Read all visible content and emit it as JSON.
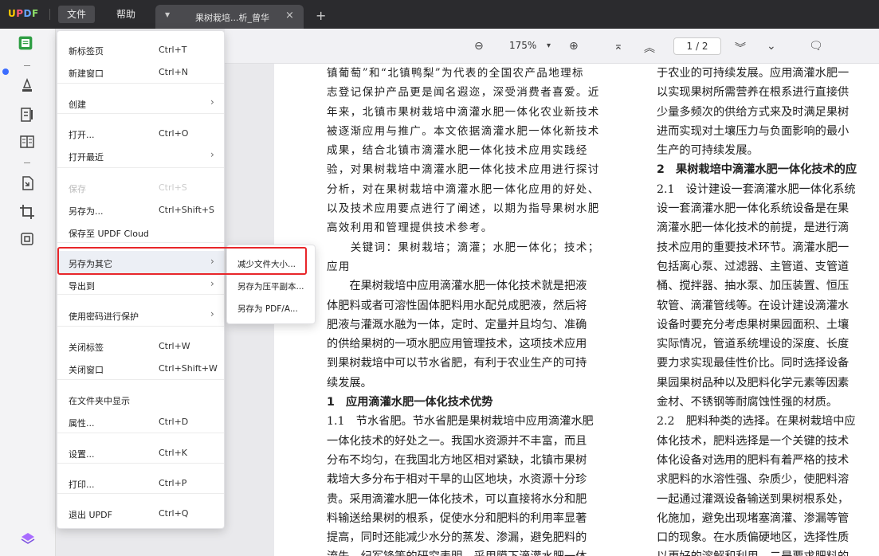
{
  "app": {
    "logo": "UPDF",
    "menus": [
      "文件",
      "帮助"
    ],
    "active_menu": "文件"
  },
  "tab": {
    "title": "果树栽培...析_曾华",
    "close": "×",
    "new_tab": "+"
  },
  "toolbar": {
    "zoom_out": "⊖",
    "zoom": "175%",
    "zoom_dropdown": "▾",
    "zoom_in": "⊕",
    "first_page": "⌅",
    "prev_page": "︽",
    "page_indicator": "1 / 2",
    "next_page": "︾",
    "last_page": "⌄",
    "comment": "🗨"
  },
  "file_menu": {
    "items": [
      {
        "label": "新标签页",
        "shortcut": "Ctrl+T"
      },
      {
        "label": "新建窗口",
        "shortcut": "Ctrl+N"
      },
      {
        "label": "创建",
        "shortcut": "",
        "submenu": true
      },
      {
        "label": "打开...",
        "shortcut": "Ctrl+O"
      },
      {
        "label": "打开最近",
        "shortcut": "",
        "submenu": true
      },
      {
        "label": "保存",
        "shortcut": "Ctrl+S",
        "disabled": true
      },
      {
        "label": "另存为...",
        "shortcut": "Ctrl+Shift+S"
      },
      {
        "label": "保存至 UPDF Cloud",
        "shortcut": ""
      },
      {
        "label": "另存为其它",
        "shortcut": "",
        "submenu": true,
        "highlighted": true
      },
      {
        "label": "导出到",
        "shortcut": "",
        "submenu": true
      },
      {
        "label": "使用密码进行保护",
        "shortcut": "",
        "submenu": true
      },
      {
        "label": "关闭标签",
        "shortcut": "Ctrl+W"
      },
      {
        "label": "关闭窗口",
        "shortcut": "Ctrl+Shift+W"
      },
      {
        "label": "在文件夹中显示",
        "shortcut": ""
      },
      {
        "label": "属性...",
        "shortcut": "Ctrl+D"
      },
      {
        "label": "设置...",
        "shortcut": "Ctrl+K"
      },
      {
        "label": "打印...",
        "shortcut": "Ctrl+P"
      },
      {
        "label": "退出 UPDF",
        "shortcut": "Ctrl+Q"
      }
    ],
    "arrow": "›"
  },
  "save_as_other_submenu": {
    "items": [
      "减少文件大小...",
      "另存为压平副本...",
      "另存为 PDF/A..."
    ]
  },
  "document": {
    "col1": [
      "镇葡萄”和“北镇鸭梨”为代表的全国农产品地理标",
      "志登记保护产品更是闻名遐迩，深受消费者喜爱。近",
      "年来，北镇市果树栽培中滴灌水肥一体化农业新技术",
      "被逐渐应用与推广。本文依据滴灌水肥一体化新技术",
      "成果，结合北镇市滴灌水肥一体化技术应用实践经",
      "验，对果树栽培中滴灌水肥一体化技术应用进行探讨",
      "分析，对在果树栽培中滴灌水肥一体化应用的好处、",
      "以及技术应用要点进行了阐述，以期为指导果树水肥",
      "高效利用和管理提供技术参考。",
      "　　关键词：果树栽培；滴灌；水肥一体化；技术；",
      "应用",
      "　　在果树栽培中应用滴灌水肥一体化技术就是把液",
      "体肥料或者可溶性固体肥料用水配兑成肥液，然后将",
      "肥液与灌溉水融为一体，定时、定量并且均匀、准确",
      "的供给果树的一项水肥应用管理技术，这项技术应用",
      "到果树栽培中可以节水省肥，有利于农业生产的可持",
      "续发展。",
      "1　应用滴灌水肥一体化技术优势",
      "1.1　节水省肥。节水省肥是果树栽培中应用滴灌水肥",
      "一体化技术的好处之一。我国水资源并不丰富，而且",
      "分布不均匀，在我国北方地区相对紧缺，北镇市果树",
      "栽培大多分布于相对干旱的山区地块，水资源十分珍",
      "贵。采用滴灌水肥一体化技术，可以直接将水分和肥",
      "料输送给果树的根系，促使水分和肥料的利用率显著",
      "提高，同时还能减少水分的蒸发、渗漏，避免肥料的",
      "流失。纪军锋等的研究表明，采用膜下滴灌水肥一体"
    ],
    "col2": [
      "于农业的可持续发展。应用滴灌水肥一",
      "以实现果树所需营养在根系进行直接供",
      "少量多频次的供给方式来及时满足果树",
      "进而实现对土壤压力与负面影响的最小",
      "生产的可持续发展。",
      "2　果树栽培中滴灌水肥一体化技术的应",
      "2.1　设计建设一套滴灌水肥一体化系统",
      "设一套滴灌水肥一体化系统设备是在果",
      "滴灌水肥一体化技术的前提，是进行滴",
      "技术应用的重要技术环节。滴灌水肥一",
      "包括离心泵、过滤器、主管道、支管道",
      "桶、搅拌器、抽水泵、加压装置、恒压",
      "软管、滴灌管线等。在设计建设滴灌水",
      "设备时要充分考虑果树果园面积、土壤",
      "实际情况，管道系统埋设的深度、长度",
      "要力求实现最佳性价比。同时选择设备",
      "果园果树品种以及肥料化学元素等因素",
      "金材、不锈钢等耐腐蚀性强的材质。",
      "2.2　肥料种类的选择。在果树栽培中应",
      "体化技术，肥料选择是一个关键的技术",
      "体化设备对选用的肥料有着严格的技术",
      "求肥料的水溶性强、杂质少，使肥料溶",
      "一起通过灌溉设备输送到果树根系处，",
      "化施加，避免出现堵塞滴灌、渗漏等管",
      "口的现象。在水质偏硬地区，选择性质",
      "以更好的溶解和利用，二是要求肥料的"
    ]
  },
  "colors": {
    "titlebar": "#2b2b2e",
    "highlight_border": "#e8262a",
    "sidebar_active": "#2f9e44"
  }
}
